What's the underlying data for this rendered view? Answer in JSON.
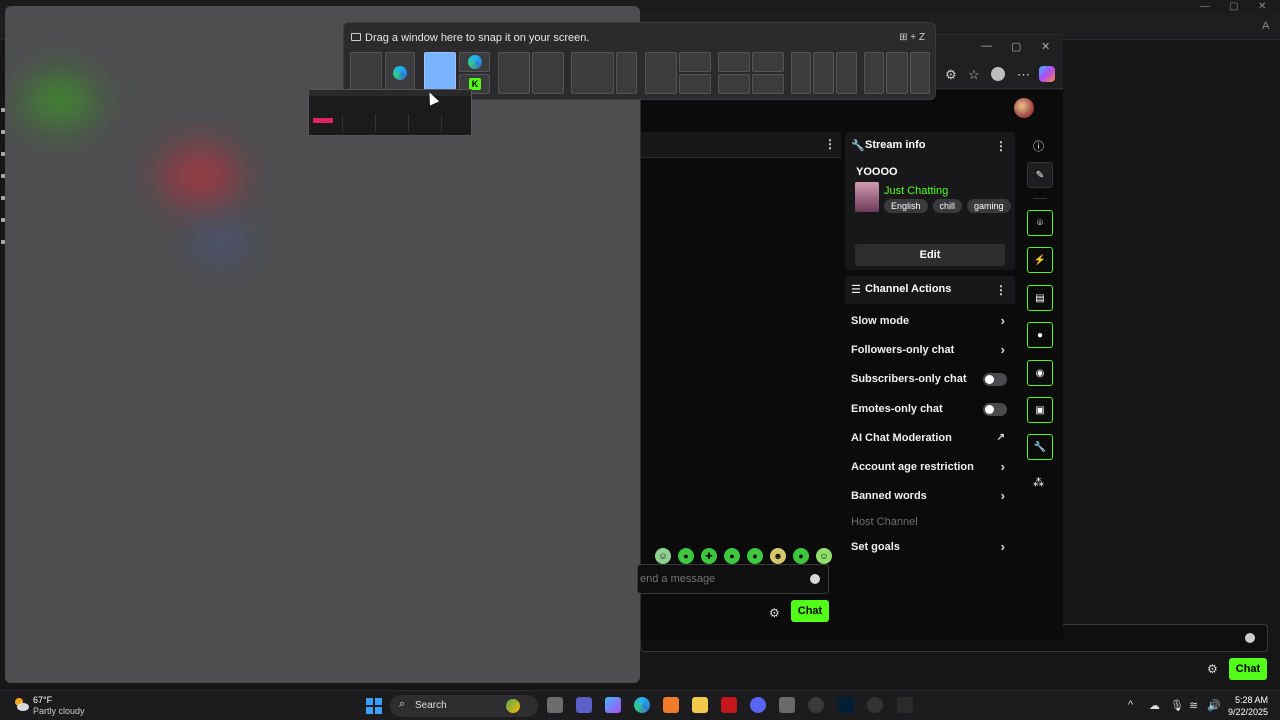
{
  "snap": {
    "title": "Drag a window here to snap it on your screen.",
    "shortcut_key": "Z"
  },
  "stream_info": {
    "header": "Stream info",
    "title": "YOOOO",
    "category": "Just Chatting",
    "tags": [
      "English",
      "chill",
      "gaming"
    ],
    "edit_label": "Edit"
  },
  "channel_actions": {
    "header": "Channel Actions",
    "items": [
      {
        "label": "Slow mode",
        "control": "chevron"
      },
      {
        "label": "Followers-only chat",
        "control": "chevron"
      },
      {
        "label": "Subscribers-only chat",
        "control": "toggle",
        "on": false
      },
      {
        "label": "Emotes-only chat",
        "control": "toggle",
        "on": false
      },
      {
        "label": "AI Chat Moderation",
        "control": "external"
      },
      {
        "label": "Account age restriction",
        "control": "chevron"
      },
      {
        "label": "Banned words",
        "control": "chevron"
      },
      {
        "label": "Host Channel",
        "control": "none",
        "disabled": true
      },
      {
        "label": "Set goals",
        "control": "chevron"
      }
    ]
  },
  "chat": {
    "placeholder": "end a message",
    "send_label": "Chat",
    "bg_send_label": "Chat"
  },
  "taskbar": {
    "temp": "67°F",
    "condition": "Partly cloudy",
    "search_label": "Search",
    "time": "5:28 AM",
    "date": "9/22/2025"
  },
  "colors": {
    "accent": "#53fc18",
    "snap_highlight": "#7ab4ff"
  }
}
